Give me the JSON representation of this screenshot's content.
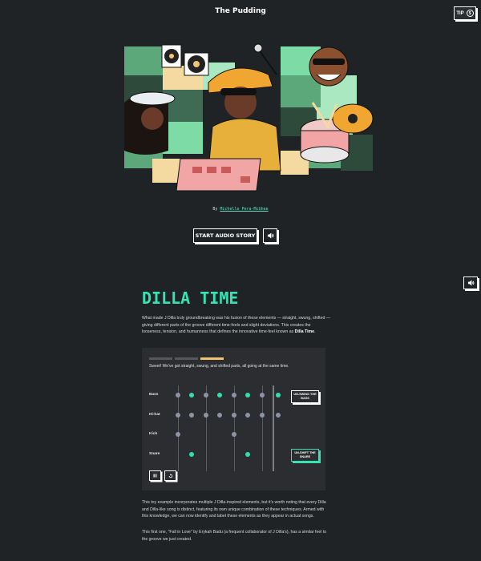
{
  "header": {
    "brand": "The Pudding",
    "tip_label": "TIP",
    "tip_badge": "$"
  },
  "hero": {
    "byline_prefix": "By",
    "author": "Michelle Pera-McGhee"
  },
  "controls": {
    "start_label": "START AUDIO STORY"
  },
  "article": {
    "title": "DILLA TIME",
    "intro_text": "What made J Dilla truly groundbreaking was his fusion of these elements — straight, swung, shifted — giving different parts of the groove different time-feels and slight deviations. This creates the looseness, tension, and humanness that defines the innovative time-feel known as",
    "intro_bold": "Dilla Time",
    "intro_end": ".",
    "para2": "This toy example incorporates multiple J Dilla-inspired elements, but it's worth noting that every Dilla and Dilla-like song is distinct, featuring its own unique combination of these techniques. Armed with this knowledge, we can now identify and label these elements as they appear in actual songs.",
    "para3": "This first one, \"Fall in Love\" by Erykah Badu (a frequent collaborator of J Dilla's), has a similar feel to the groove we just created."
  },
  "interactive": {
    "message": "Sweet! We've got straight, swung, and shifted parts, all going at the same time.",
    "progress_steps": 3,
    "active_step": 3,
    "rows": [
      {
        "label": "Bass",
        "dots": [
          [
            "grey",
            0
          ],
          [
            "teal",
            1
          ],
          [
            "grey",
            2
          ],
          [
            "teal",
            3
          ],
          [
            "grey",
            4
          ],
          [
            "teal",
            5
          ],
          [
            "grey",
            6
          ],
          [
            "teal",
            7
          ]
        ]
      },
      {
        "label": "Hi-hat",
        "dots": [
          [
            "grey",
            0
          ],
          [
            "grey",
            1
          ],
          [
            "grey",
            2
          ],
          [
            "grey",
            3
          ],
          [
            "grey",
            4
          ],
          [
            "grey",
            5
          ],
          [
            "grey",
            6
          ],
          [
            "grey",
            7
          ]
        ]
      },
      {
        "label": "Kick",
        "dots": [
          [
            "grey",
            0
          ],
          [
            "grey",
            4
          ]
        ]
      },
      {
        "label": "Snare",
        "dots": [
          [
            "teal",
            1
          ],
          [
            "teal",
            5
          ]
        ]
      }
    ],
    "unswing_label": "UN-SWING THE BASS",
    "unshift_label": "UN-SHIFT THE SNARE",
    "pause_icon": "pause-icon",
    "restart_icon": "restart-icon"
  },
  "colors": {
    "accent": "#36e3b4",
    "background": "#1f2326",
    "progress_active": "#f0c470"
  }
}
